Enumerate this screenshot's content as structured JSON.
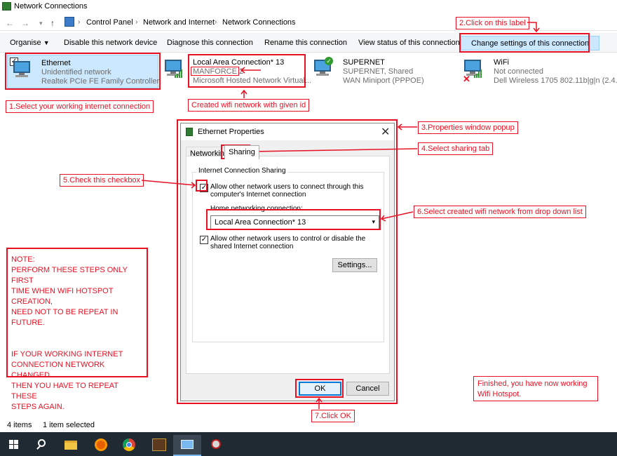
{
  "window": {
    "title": "Network Connections"
  },
  "breadcrumb": [
    "Control Panel",
    "Network and Internet",
    "Network Connections"
  ],
  "toolbar": {
    "organise": "Organise",
    "disable": "Disable this network device",
    "diagnose": "Diagnose this connection",
    "rename": "Rename this connection",
    "view_status": "View status of this connection",
    "change_settings": "Change settings of this connection"
  },
  "connections": [
    {
      "name": "Ethernet",
      "line1": "Unidentified network",
      "line2": "Realtek PCIe FE Family Controller"
    },
    {
      "name": "Local Area Connection* 13",
      "line1": "MANFORCE  2",
      "line2": "Microsoft Hosted Network Virtual..."
    },
    {
      "name": "SUPERNET",
      "line1": "SUPERNET, Shared",
      "line2": "WAN Miniport (PPPOE)"
    },
    {
      "name": "WiFi",
      "line1": "Not connected",
      "line2": "Dell Wireless 1705 802.11b|g|n (2.4..."
    }
  ],
  "dialog": {
    "title": "Ethernet Properties",
    "tabs": [
      "Networking",
      "Sharing"
    ],
    "group_label": "Internet Connection Sharing",
    "allow_connect_1": "Allow other network users to connect through this",
    "allow_connect_2": "computer's Internet connection",
    "home_label": "Home networking connection:",
    "home_value": "Local Area Connection* 13",
    "allow_control_1": "Allow other network users to control or disable the",
    "allow_control_2": "shared Internet connection",
    "settings": "Settings...",
    "ok": "OK",
    "cancel": "Cancel"
  },
  "annotations": {
    "step1": "1.Select your working internet connection",
    "step2": "2.Click on this label",
    "created": "Created wifi network with given id",
    "step3": "3.Properties window popup",
    "step4": "4.Select sharing tab",
    "step5": "5.Check this checkbox",
    "step6": "6.Select created wifi network from drop down list",
    "step7": "7.Click OK",
    "note": [
      "NOTE:",
      "PERFORM THESE STEPS ONLY FIRST",
      "TIME WHEN WIFI HOTSPOT",
      "CREATION,",
      "NEED NOT TO BE REPEAT IN FUTURE.",
      "",
      "",
      "IF YOUR WORKING INTERNET",
      "CONNECTION NETWORK CHANGED",
      "THEN YOU HAVE TO REPEAT THESE",
      "STEPS AGAIN."
    ],
    "finished_1": "Finished, you have now working",
    "finished_2": "Wifi Hotspot."
  },
  "status": {
    "items": "4 items",
    "selected": "1 item selected"
  },
  "colors": {
    "annotation": "#e81123",
    "selection": "#cce8ff",
    "taskbar": "#1f2a33"
  }
}
